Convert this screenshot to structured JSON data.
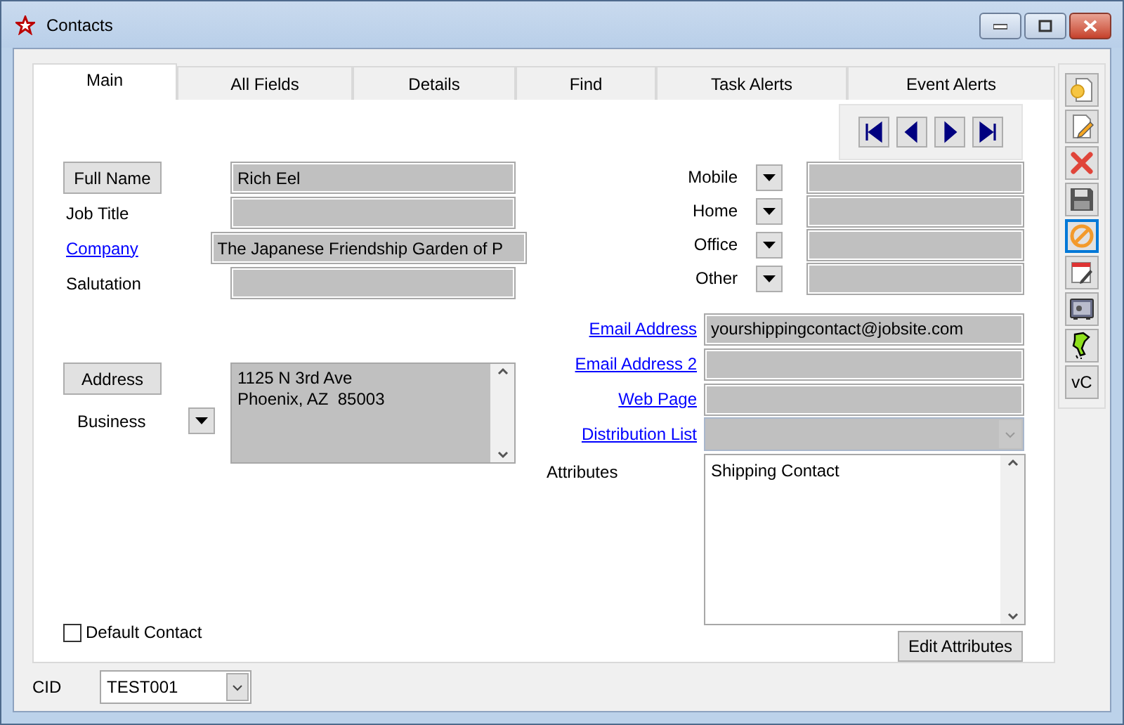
{
  "window": {
    "title": "Contacts"
  },
  "tabs": [
    {
      "label": "Main",
      "selected": true
    },
    {
      "label": "All Fields",
      "selected": false
    },
    {
      "label": "Details",
      "selected": false
    },
    {
      "label": "Find",
      "selected": false
    },
    {
      "label": "Task Alerts",
      "selected": false
    },
    {
      "label": "Event Alerts",
      "selected": false
    }
  ],
  "name_fields": [
    {
      "label": "Full Name",
      "kind": "button",
      "value": "Rich Eel",
      "wide": false
    },
    {
      "label": "Job Title",
      "kind": "text",
      "wide": false
    },
    {
      "label": "Company",
      "kind": "link",
      "value": "The Japanese Friendship Garden of P",
      "wide": true
    },
    {
      "label": "Salutation",
      "kind": "text",
      "wide": false
    }
  ],
  "address": {
    "button": "Address",
    "type": "Business",
    "lines": [
      "1125 N 3rd Ave",
      "Phoenix, AZ  85003"
    ]
  },
  "phones": [
    {
      "label": "Mobile"
    },
    {
      "label": "Home"
    },
    {
      "label": "Office"
    },
    {
      "label": "Other"
    }
  ],
  "web_fields": [
    {
      "label": "Email Address",
      "kind": "text",
      "value": "yourshippingcontact@jobsite.com"
    },
    {
      "label": "Email Address 2",
      "kind": "text"
    },
    {
      "label": "Web Page",
      "kind": "text"
    },
    {
      "label": "Distribution List",
      "kind": "combo"
    }
  ],
  "attributes": {
    "label": "Attributes",
    "value": "Shipping Contact",
    "button": "Edit Attributes"
  },
  "default_contact": {
    "label": "Default Contact",
    "checked": false
  },
  "cid": {
    "label": "CID",
    "value": "TEST001"
  },
  "toolbar": [
    {
      "kind": "new",
      "selected": false
    },
    {
      "kind": "edit",
      "selected": false
    },
    {
      "kind": "delete",
      "selected": false
    },
    {
      "kind": "save",
      "selected": false
    },
    {
      "kind": "cancel",
      "selected": true
    },
    {
      "kind": "calendar",
      "selected": false
    },
    {
      "kind": "vault",
      "selected": false
    },
    {
      "kind": "pin",
      "selected": false
    },
    {
      "kind": "text",
      "label": "vC",
      "selected": false
    }
  ]
}
